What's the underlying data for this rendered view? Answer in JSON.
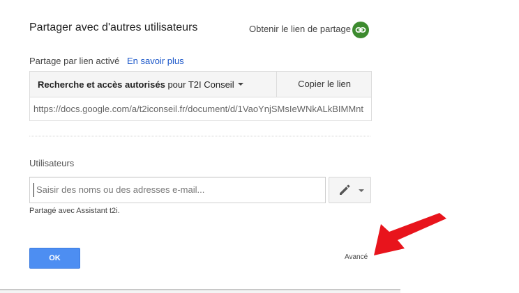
{
  "dialog": {
    "title": "Partager avec d'autres utilisateurs",
    "get_link_label": "Obtenir le lien de partage",
    "link_status": "Partage par lien activé",
    "learn_more": "En savoir plus",
    "access": {
      "mode_bold": "Recherche et accès autorisés",
      "mode_suffix": " pour T2I Conseil",
      "copy_label": "Copier le lien",
      "url": "https://docs.google.com/a/t2iconseil.fr/document/d/1VaoYnjSMsIeWNkALkBIMMnt"
    },
    "users": {
      "label": "Utilisateurs",
      "placeholder": "Saisir des noms ou des adresses e-mail...",
      "shared_with": "Partagé avec Assistant t2i."
    },
    "ok_label": "OK",
    "advanced_label": "Avancé"
  },
  "colors": {
    "accent_blue": "#4d8ef2",
    "link_blue": "#1a56c9",
    "link_icon_green": "#3d8b2f",
    "annotation_arrow": "#e8141c"
  },
  "icons": [
    "link-icon",
    "pencil-icon",
    "chevron-down-icon",
    "annotation-arrow"
  ]
}
